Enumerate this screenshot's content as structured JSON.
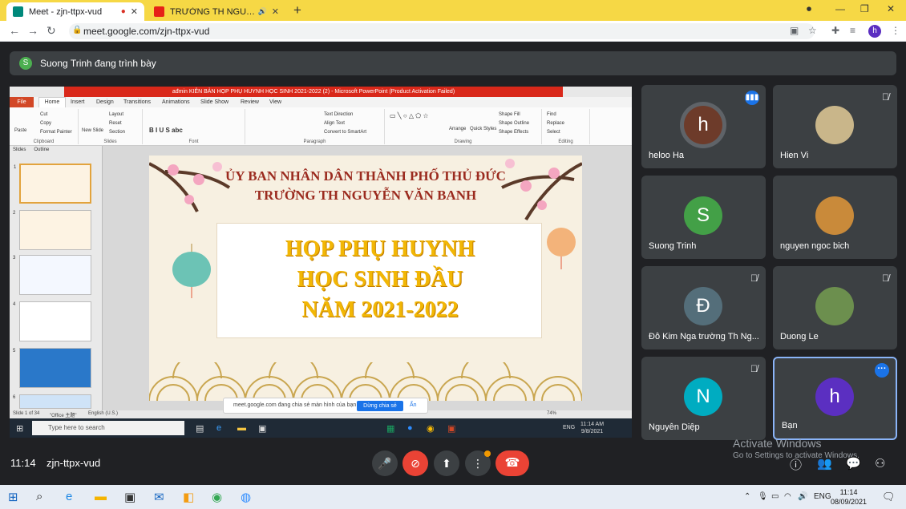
{
  "browser": {
    "tabs": [
      {
        "title": "Meet - zjn-ttpx-vud",
        "active": true
      },
      {
        "title": "TRƯỜNG TH NGUYỄN VĂN BANH",
        "active": false
      }
    ],
    "url": "meet.google.com/zjn-ttpx-vud",
    "profile_initial": "h"
  },
  "presenting": {
    "initial": "S",
    "text": "Suong Trinh đang trình bày"
  },
  "powerpoint": {
    "window_title": "ađmin KIÊN BẢN HỌP PHỤ HUYNH HỌC SINH 2021-2022 (2) - Microsoft PowerPoint (Product Activation Failed)",
    "tabs": [
      "File",
      "Home",
      "Insert",
      "Design",
      "Transitions",
      "Animations",
      "Slide Show",
      "Review",
      "View"
    ],
    "groups": [
      "Clipboard",
      "Slides",
      "Font",
      "Paragraph",
      "Drawing",
      "Editing"
    ],
    "clipboard_items": [
      "Cut",
      "Copy",
      "Format Painter",
      "Paste"
    ],
    "slides_items": [
      "Layout",
      "Reset",
      "Section",
      "New Slide"
    ],
    "paragraph_items": [
      "Text Direction",
      "Align Text",
      "Convert to SmartArt"
    ],
    "drawing_items": [
      "Arrange",
      "Quick Styles",
      "Shape Fill",
      "Shape Outline",
      "Shape Effects"
    ],
    "editing_items": [
      "Find",
      "Replace",
      "Select"
    ],
    "panel_tabs": [
      "Slides",
      "Outline"
    ],
    "slide_numbers": [
      "1",
      "2",
      "3",
      "4",
      "5",
      "6"
    ],
    "slide": {
      "line1": "ỦY BAN NHÂN DÂN THÀNH PHỐ THỦ ĐỨC",
      "line2": "TRƯỜNG TH NGUYỄN VĂN BANH",
      "big1": "HỌP PHỤ HUYNH",
      "big2": "HỌC SINH ĐẦU",
      "big3": "NĂM 2021-2022"
    },
    "status": {
      "slide": "Slide 1 of 34",
      "theme": "\"Office 主題\"",
      "lang": "English (U.S.)",
      "zoom": "74%"
    },
    "share_popup": {
      "text": "meet.google.com đang chia sẻ màn hình của bạn.",
      "stop": "Dừng chia sẻ",
      "hide": "Ẩn"
    },
    "taskbar": {
      "search": "Type here to search",
      "lang": "ENG",
      "time": "11:14 AM",
      "date": "9/8/2021"
    }
  },
  "participants": [
    {
      "name": "heloo Ha",
      "initial": "h",
      "color": "#6d3b2a",
      "state": "speaking"
    },
    {
      "name": "Hien Vi",
      "initial": "",
      "color": "#c9b68a",
      "state": "muted"
    },
    {
      "name": "Suong Trinh",
      "initial": "S",
      "color": "#43a047",
      "state": ""
    },
    {
      "name": "nguyen ngoc bich",
      "initial": "",
      "color": "#c98a3a",
      "state": ""
    },
    {
      "name": "Đỗ Kim Nga trường Th Ng...",
      "initial": "Đ",
      "color": "#546e7a",
      "state": "muted"
    },
    {
      "name": "Duong Le",
      "initial": "",
      "color": "#6c8f4e",
      "state": "muted"
    },
    {
      "name": "Nguyễn Diệp",
      "initial": "N",
      "color": "#00acc1",
      "state": "muted"
    },
    {
      "name": "Bạn",
      "initial": "h",
      "color": "#5b2fc1",
      "state": "me"
    }
  ],
  "meeting": {
    "time": "11:14",
    "code": "zjn-ttpx-vud"
  },
  "activate": {
    "title": "Activate Windows",
    "sub": "Go to Settings to activate Windows."
  },
  "windows_taskbar": {
    "lang": "ENG",
    "time": "11:14",
    "date": "08/09/2021"
  },
  "colors": {
    "meet_bg": "#202124",
    "tile_bg": "#3c4043",
    "leave_red": "#ea4335",
    "accent_blue": "#1a73e8"
  }
}
